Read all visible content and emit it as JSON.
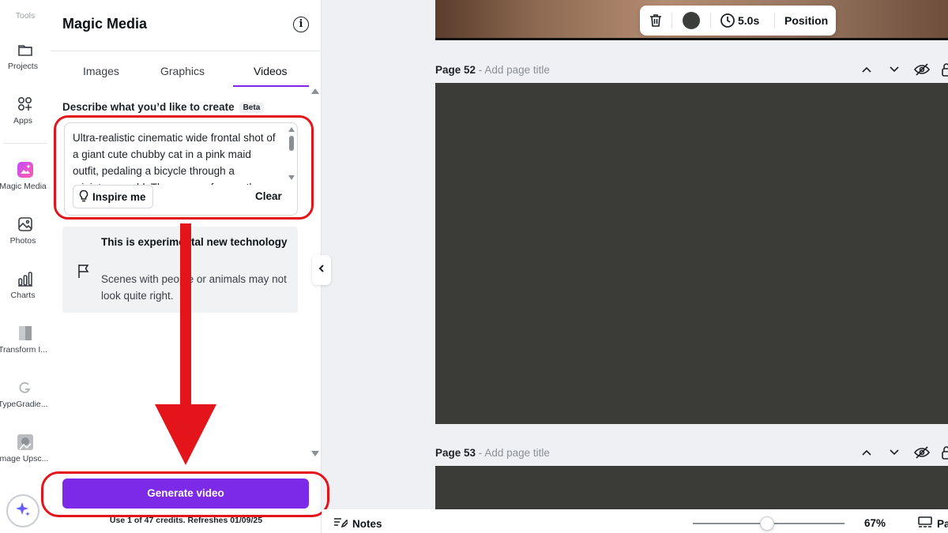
{
  "rail": {
    "tools_label": "Tools",
    "items": [
      {
        "label": "Projects",
        "icon": "folder-icon"
      },
      {
        "label": "Apps",
        "icon": "apps-icon"
      },
      {
        "label": "Magic Media",
        "icon": "magic-media-icon"
      },
      {
        "label": "Photos",
        "icon": "photos-icon"
      },
      {
        "label": "Charts",
        "icon": "charts-icon"
      },
      {
        "label": "Transform I...",
        "icon": "transform-app-icon"
      },
      {
        "label": "TypeGradie...",
        "icon": "typegradient-app-icon"
      },
      {
        "label": "Image Upsc...",
        "icon": "image-upscaler-app-icon"
      }
    ],
    "ai_icon": "sparkle-icon"
  },
  "panel": {
    "title": "Magic Media",
    "tabs": [
      {
        "label": "Images",
        "active": false
      },
      {
        "label": "Graphics",
        "active": false
      },
      {
        "label": "Videos",
        "active": true
      }
    ],
    "describe_label": "Describe what you’d like to create",
    "beta_label": "Beta",
    "prompt_value": "Ultra-realistic cinematic wide frontal shot of a giant cute chubby cat in a pink maid outfit, pedaling a bicycle through a miniature world. The camera frames the",
    "inspire_label": "Inspire me",
    "clear_label": "Clear",
    "notice_title": "This is experimental new technology",
    "notice_body": "Scenes with people or animals may not look quite right.",
    "generate_label": "Generate video",
    "credits_text": "Use 1 of 47 credits. Refreshes 01/09/25",
    "accent_color": "#7d2ae8"
  },
  "toolbar": {
    "duration": "5.0s",
    "position_label": "Position",
    "color": "#3c3e3b"
  },
  "pages": [
    {
      "label": "Page 52",
      "title_placeholder": "Add page title"
    },
    {
      "label": "Page 53",
      "title_placeholder": "Add page title"
    }
  ],
  "page_separator": " - ",
  "bottombar": {
    "notes_label": "Notes",
    "zoom": "67%",
    "zoom_fraction": 0.52,
    "pages_label": "Pages"
  },
  "annotation_color": "#e4141b"
}
